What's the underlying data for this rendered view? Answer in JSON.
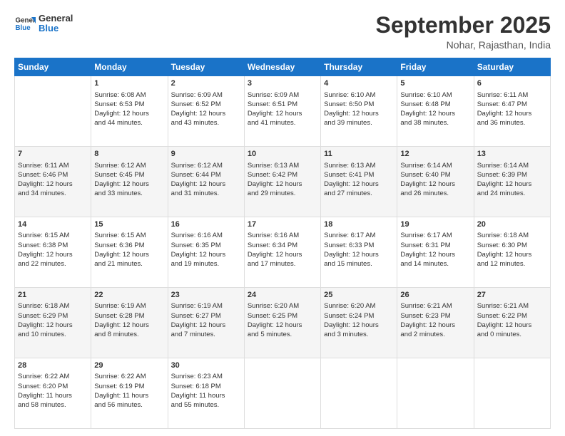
{
  "logo": {
    "line1": "General",
    "line2": "Blue"
  },
  "title": "September 2025",
  "subtitle": "Nohar, Rajasthan, India",
  "days": [
    "Sunday",
    "Monday",
    "Tuesday",
    "Wednesday",
    "Thursday",
    "Friday",
    "Saturday"
  ],
  "weeks": [
    [
      {
        "day": "",
        "info": ""
      },
      {
        "day": "1",
        "info": "Sunrise: 6:08 AM\nSunset: 6:53 PM\nDaylight: 12 hours\nand 44 minutes."
      },
      {
        "day": "2",
        "info": "Sunrise: 6:09 AM\nSunset: 6:52 PM\nDaylight: 12 hours\nand 43 minutes."
      },
      {
        "day": "3",
        "info": "Sunrise: 6:09 AM\nSunset: 6:51 PM\nDaylight: 12 hours\nand 41 minutes."
      },
      {
        "day": "4",
        "info": "Sunrise: 6:10 AM\nSunset: 6:50 PM\nDaylight: 12 hours\nand 39 minutes."
      },
      {
        "day": "5",
        "info": "Sunrise: 6:10 AM\nSunset: 6:48 PM\nDaylight: 12 hours\nand 38 minutes."
      },
      {
        "day": "6",
        "info": "Sunrise: 6:11 AM\nSunset: 6:47 PM\nDaylight: 12 hours\nand 36 minutes."
      }
    ],
    [
      {
        "day": "7",
        "info": "Sunrise: 6:11 AM\nSunset: 6:46 PM\nDaylight: 12 hours\nand 34 minutes."
      },
      {
        "day": "8",
        "info": "Sunrise: 6:12 AM\nSunset: 6:45 PM\nDaylight: 12 hours\nand 33 minutes."
      },
      {
        "day": "9",
        "info": "Sunrise: 6:12 AM\nSunset: 6:44 PM\nDaylight: 12 hours\nand 31 minutes."
      },
      {
        "day": "10",
        "info": "Sunrise: 6:13 AM\nSunset: 6:42 PM\nDaylight: 12 hours\nand 29 minutes."
      },
      {
        "day": "11",
        "info": "Sunrise: 6:13 AM\nSunset: 6:41 PM\nDaylight: 12 hours\nand 27 minutes."
      },
      {
        "day": "12",
        "info": "Sunrise: 6:14 AM\nSunset: 6:40 PM\nDaylight: 12 hours\nand 26 minutes."
      },
      {
        "day": "13",
        "info": "Sunrise: 6:14 AM\nSunset: 6:39 PM\nDaylight: 12 hours\nand 24 minutes."
      }
    ],
    [
      {
        "day": "14",
        "info": "Sunrise: 6:15 AM\nSunset: 6:38 PM\nDaylight: 12 hours\nand 22 minutes."
      },
      {
        "day": "15",
        "info": "Sunrise: 6:15 AM\nSunset: 6:36 PM\nDaylight: 12 hours\nand 21 minutes."
      },
      {
        "day": "16",
        "info": "Sunrise: 6:16 AM\nSunset: 6:35 PM\nDaylight: 12 hours\nand 19 minutes."
      },
      {
        "day": "17",
        "info": "Sunrise: 6:16 AM\nSunset: 6:34 PM\nDaylight: 12 hours\nand 17 minutes."
      },
      {
        "day": "18",
        "info": "Sunrise: 6:17 AM\nSunset: 6:33 PM\nDaylight: 12 hours\nand 15 minutes."
      },
      {
        "day": "19",
        "info": "Sunrise: 6:17 AM\nSunset: 6:31 PM\nDaylight: 12 hours\nand 14 minutes."
      },
      {
        "day": "20",
        "info": "Sunrise: 6:18 AM\nSunset: 6:30 PM\nDaylight: 12 hours\nand 12 minutes."
      }
    ],
    [
      {
        "day": "21",
        "info": "Sunrise: 6:18 AM\nSunset: 6:29 PM\nDaylight: 12 hours\nand 10 minutes."
      },
      {
        "day": "22",
        "info": "Sunrise: 6:19 AM\nSunset: 6:28 PM\nDaylight: 12 hours\nand 8 minutes."
      },
      {
        "day": "23",
        "info": "Sunrise: 6:19 AM\nSunset: 6:27 PM\nDaylight: 12 hours\nand 7 minutes."
      },
      {
        "day": "24",
        "info": "Sunrise: 6:20 AM\nSunset: 6:25 PM\nDaylight: 12 hours\nand 5 minutes."
      },
      {
        "day": "25",
        "info": "Sunrise: 6:20 AM\nSunset: 6:24 PM\nDaylight: 12 hours\nand 3 minutes."
      },
      {
        "day": "26",
        "info": "Sunrise: 6:21 AM\nSunset: 6:23 PM\nDaylight: 12 hours\nand 2 minutes."
      },
      {
        "day": "27",
        "info": "Sunrise: 6:21 AM\nSunset: 6:22 PM\nDaylight: 12 hours\nand 0 minutes."
      }
    ],
    [
      {
        "day": "28",
        "info": "Sunrise: 6:22 AM\nSunset: 6:20 PM\nDaylight: 11 hours\nand 58 minutes."
      },
      {
        "day": "29",
        "info": "Sunrise: 6:22 AM\nSunset: 6:19 PM\nDaylight: 11 hours\nand 56 minutes."
      },
      {
        "day": "30",
        "info": "Sunrise: 6:23 AM\nSunset: 6:18 PM\nDaylight: 11 hours\nand 55 minutes."
      },
      {
        "day": "",
        "info": ""
      },
      {
        "day": "",
        "info": ""
      },
      {
        "day": "",
        "info": ""
      },
      {
        "day": "",
        "info": ""
      }
    ]
  ]
}
